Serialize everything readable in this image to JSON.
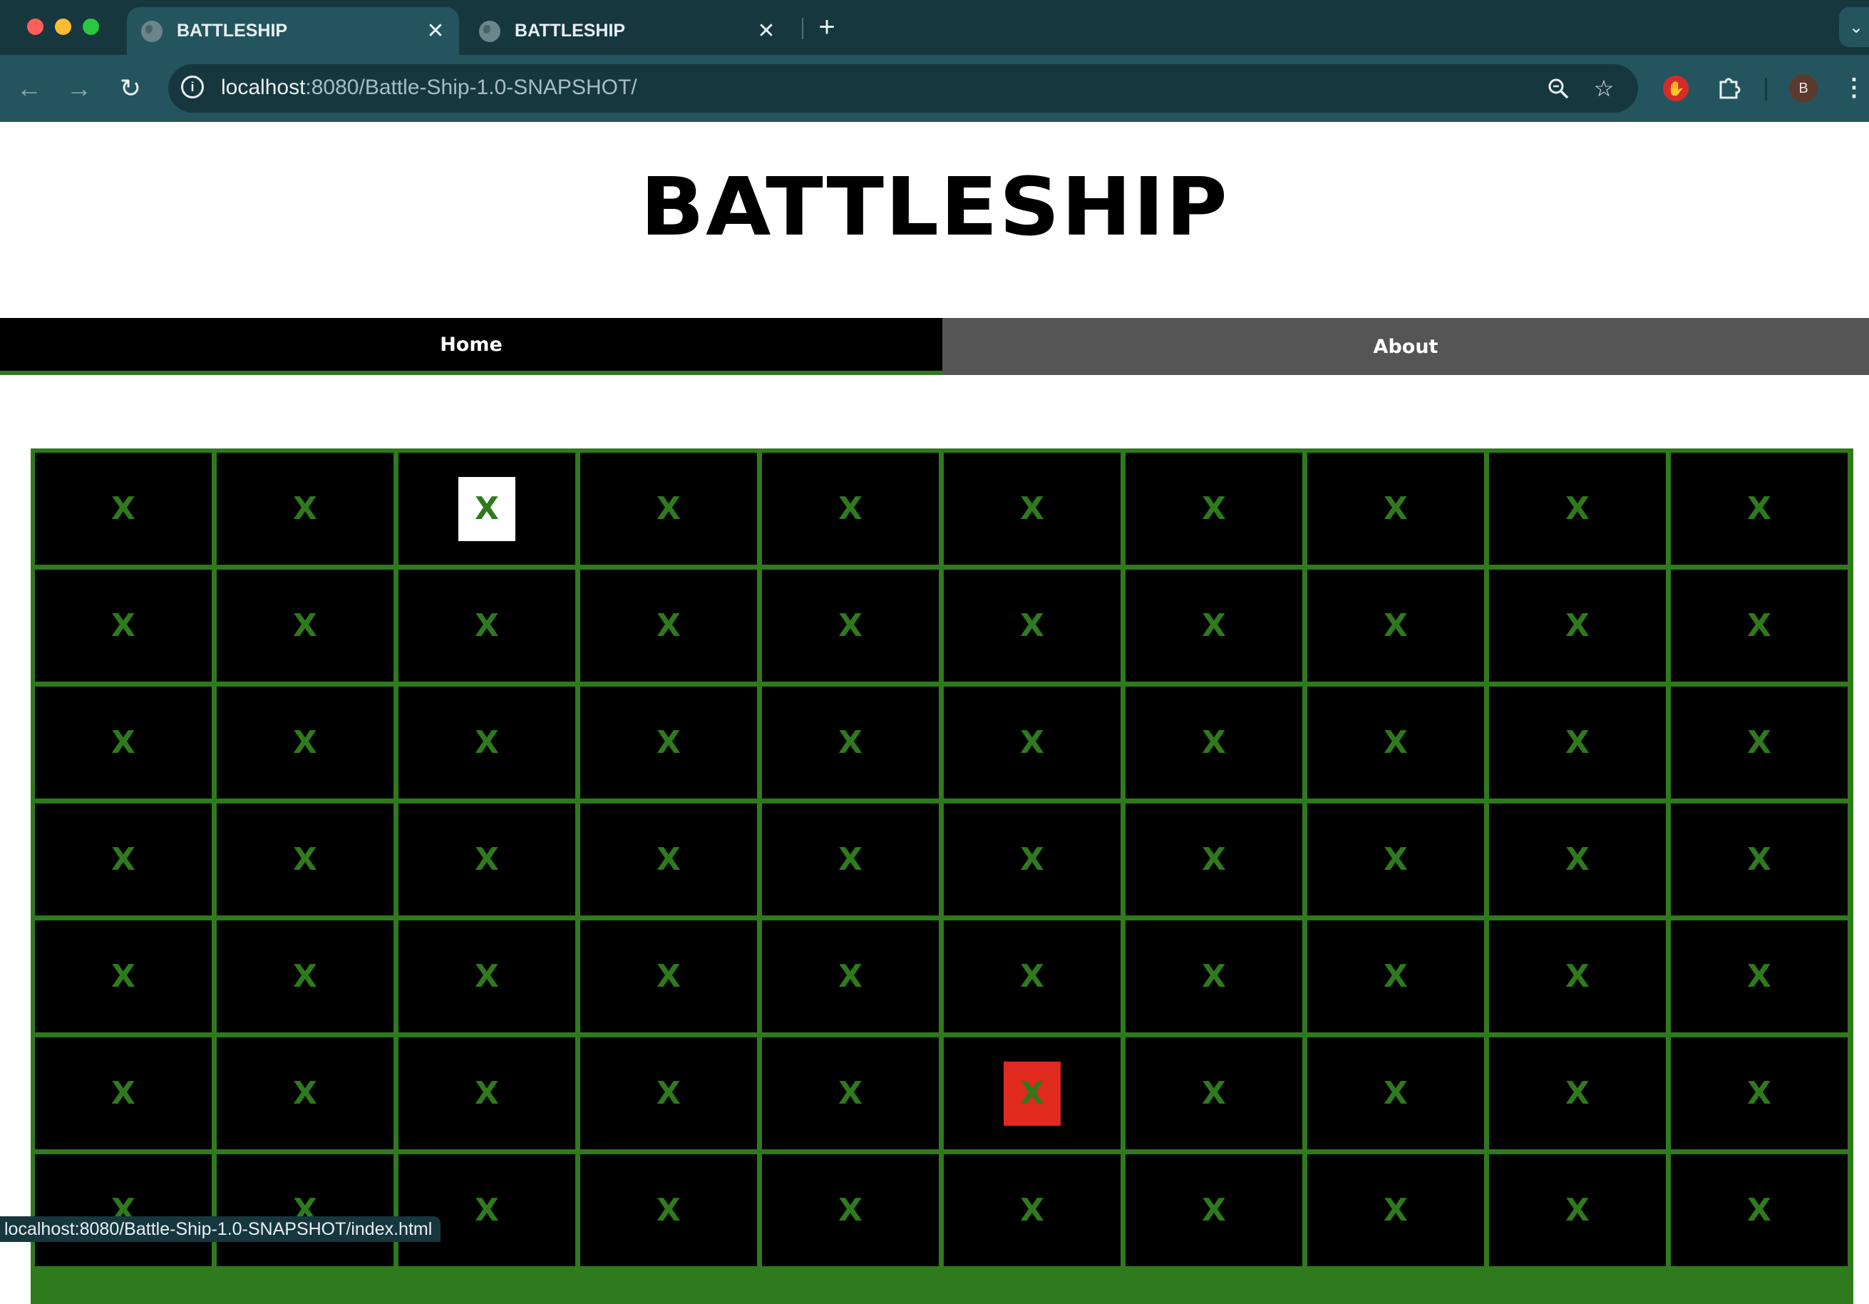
{
  "browser": {
    "tabs": [
      {
        "title": "BATTLESHIP",
        "active": true
      },
      {
        "title": "BATTLESHIP",
        "active": false
      }
    ],
    "new_tab_glyph": "+",
    "close_glyph": "✕",
    "url_host": "localhost",
    "url_path": ":8080/Battle-Ship-1.0-SNAPSHOT/",
    "profile_initial": "B",
    "status_url": "localhost:8080/Battle-Ship-1.0-SNAPSHOT/index.html"
  },
  "page": {
    "title": "BATTLESHIP",
    "nav": {
      "home": "Home",
      "about": "About"
    }
  },
  "board": {
    "marker": "X",
    "rows": 7,
    "cols": 10,
    "cell_states": [
      [
        "none",
        "none",
        "hit",
        "none",
        "none",
        "none",
        "none",
        "none",
        "none",
        "none"
      ],
      [
        "none",
        "none",
        "none",
        "none",
        "none",
        "none",
        "none",
        "none",
        "none",
        "none"
      ],
      [
        "none",
        "none",
        "none",
        "none",
        "none",
        "none",
        "none",
        "none",
        "none",
        "none"
      ],
      [
        "none",
        "none",
        "none",
        "none",
        "none",
        "none",
        "none",
        "none",
        "none",
        "none"
      ],
      [
        "none",
        "none",
        "none",
        "none",
        "none",
        "none",
        "none",
        "none",
        "none",
        "none"
      ],
      [
        "none",
        "none",
        "none",
        "none",
        "none",
        "miss",
        "none",
        "none",
        "none",
        "none"
      ],
      [
        "none",
        "none",
        "none",
        "none",
        "none",
        "none",
        "none",
        "none",
        "none",
        "none"
      ]
    ]
  },
  "colors": {
    "chrome_dark": "#17373f",
    "chrome_toolbar": "#24555e",
    "grid_green": "#2f7a1d",
    "marker_green": "#2f7a1d",
    "cell_black": "#000000",
    "highlight_white": "#ffffff",
    "highlight_red": "#e0291f",
    "about_gray": "#555555"
  },
  "icons": {
    "back": "arrow-left-icon",
    "forward": "arrow-right-icon",
    "reload": "reload-icon",
    "site_info": "info-icon",
    "zoom": "magnifier-zoom-icon",
    "bookmark": "star-icon",
    "adblock": "stop-hand-icon",
    "extensions": "puzzle-icon",
    "menu": "kebab-menu-icon",
    "tab_favicon": "globe-icon"
  }
}
